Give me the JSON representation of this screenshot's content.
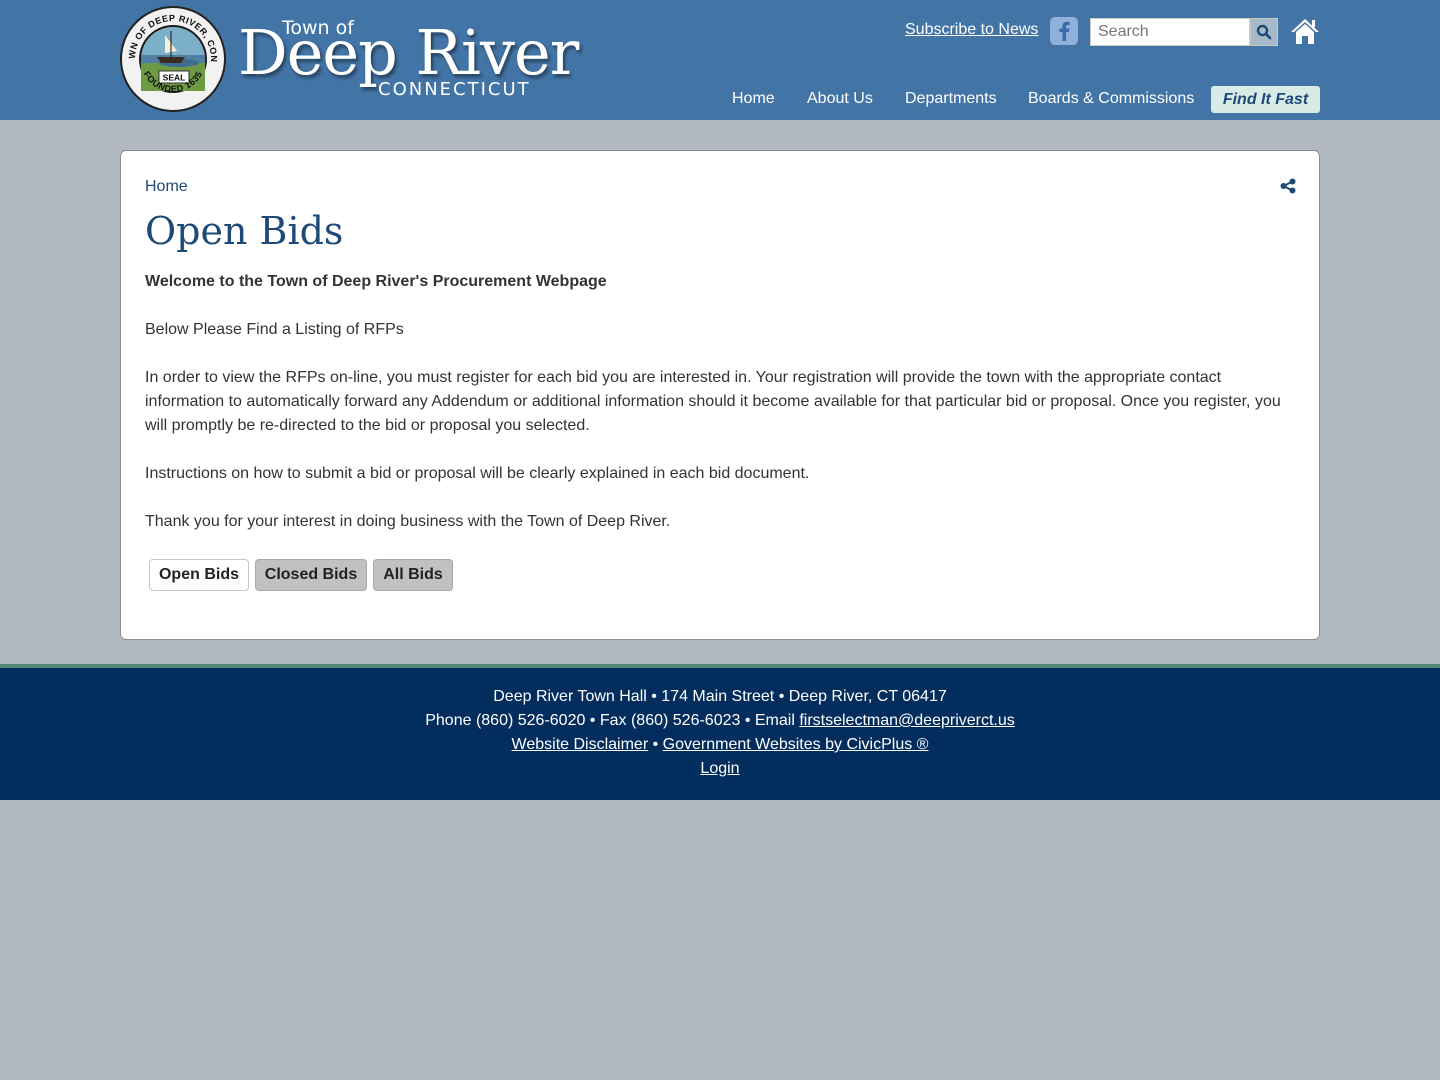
{
  "header": {
    "seal": {
      "ring_text_top": "TOWN OF DEEP RIVER, CONN.",
      "ring_text_bottom": "FOUNDED 1635",
      "center_label": "SEAL"
    },
    "logo": {
      "town_of": "Town of",
      "name": "Deep River",
      "state": "CONNECTICUT"
    },
    "subscribe_link": "Subscribe to News",
    "search_placeholder": "Search",
    "nav": [
      "Home",
      "About Us",
      "Departments",
      "Boards & Commissions"
    ],
    "find_it_fast": "Find It Fast",
    "colors": {
      "header_bg": "#4374a6",
      "find_fast_bg": "#d8ebe6"
    },
    "icons": [
      "facebook-icon",
      "search-icon",
      "home-icon"
    ]
  },
  "content": {
    "breadcrumb": "Home",
    "title": "Open Bids",
    "intro": "Welcome to the Town of Deep River's Procurement Webpage",
    "paragraphs": [
      "Below Please Find a Listing of RFPs",
      "In order to view the RFPs on-line, you must register for each bid you are interested in. Your registration will provide the town with the appropriate contact information to automatically forward any Addendum or additional information should it become available for that particular bid or proposal. Once you register, you will promptly be re-directed to the bid or proposal you selected.",
      "Instructions on how to submit a bid or proposal will be clearly explained in each bid document.",
      "Thank you for your interest in doing business with the Town of Deep River."
    ],
    "tabs": {
      "open": "Open Bids",
      "closed": "Closed Bids",
      "all": "All Bids",
      "selected": "Open Bids"
    },
    "share_icon": "share-icon"
  },
  "footer": {
    "address": "Deep River Town Hall • 174 Main Street • Deep River, CT 06417",
    "phone_fax": "Phone (860) 526-6020 • Fax (860) 526-6023 • Email ",
    "email": "firstselectman@deepriverct.us",
    "disclaimer": "Website Disclaimer",
    "separator": " • ",
    "civicplus": "Government Websites by CivicPlus ®",
    "login": "Login",
    "colors": {
      "footer_bg": "#032d5c",
      "stripe": "#4f8a76"
    }
  }
}
